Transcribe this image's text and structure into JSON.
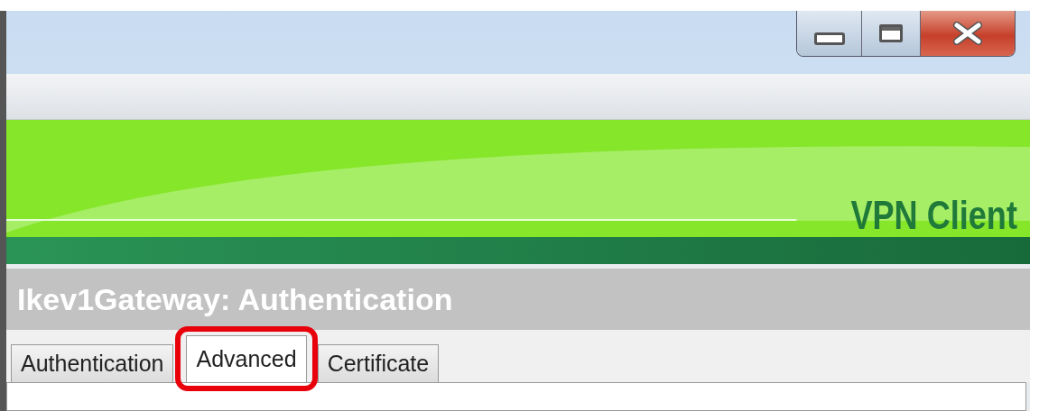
{
  "window": {
    "caption_buttons": [
      {
        "kind": "minimize"
      },
      {
        "kind": "maximize"
      },
      {
        "kind": "close"
      }
    ]
  },
  "banner": {
    "title": "VPN Client"
  },
  "panel": {
    "title": "Ikev1Gateway: Authentication"
  },
  "tabs": [
    {
      "label": "Authentication",
      "selected": false,
      "highlighted": false
    },
    {
      "label": "Advanced",
      "selected": true,
      "highlighted": true
    },
    {
      "label": "Certificate",
      "selected": false,
      "highlighted": false
    }
  ]
}
